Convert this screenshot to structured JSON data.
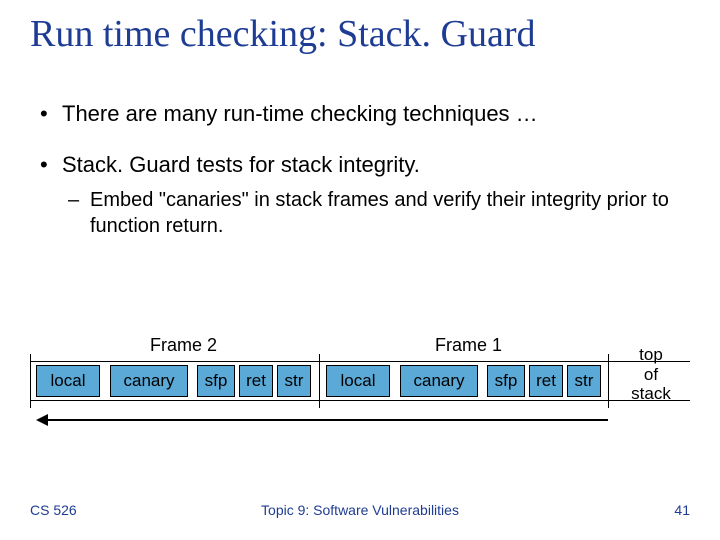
{
  "title": "Run time checking: Stack. Guard",
  "bullets": {
    "b1a": "There are many run-time checking techniques …",
    "b1b": "Stack. Guard tests for stack integrity.",
    "b2a": "Embed \"canaries\" in stack frames and verify their integrity prior to function return."
  },
  "diagram": {
    "frame2_label": "Frame 2",
    "frame1_label": "Frame 1",
    "cells": {
      "local1": "local",
      "canary1": "canary",
      "sfp1": "sfp",
      "ret1": "ret",
      "str1": "str",
      "local2": "local",
      "canary2": "canary",
      "sfp2": "sfp",
      "ret2": "ret",
      "str2": "str"
    },
    "tos": "top\nof\nstack"
  },
  "footer": {
    "left": "CS 526",
    "center": "Topic 9: Software Vulnerabilities",
    "right": "41"
  }
}
